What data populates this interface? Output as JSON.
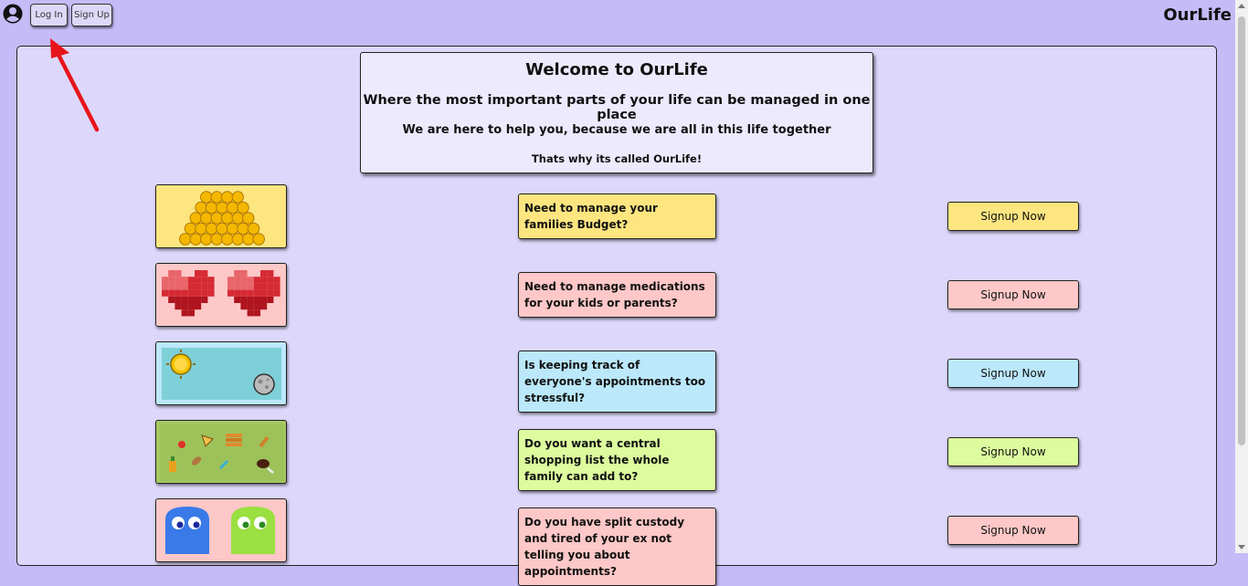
{
  "header": {
    "brand": "OurLife",
    "login_label": "Log In",
    "signup_label": "Sign Up"
  },
  "welcome": {
    "title": "Welcome to OurLife",
    "subtitle": "Where the most important parts of your life can be managed in one place",
    "line3": "We are here to help you, because we are all in this life together",
    "line4": "Thats why its called OurLife!"
  },
  "features": [
    {
      "icon": "gold-coins-icon",
      "question": "Need to manage your families Budget?",
      "button": "Signup Now",
      "color": "#fde580"
    },
    {
      "icon": "pixel-hearts-icon",
      "question": "Need to manage medications for your kids or parents?",
      "button": "Signup Now",
      "color": "#fdc8c7"
    },
    {
      "icon": "sun-moon-icon",
      "question": "Is keeping track of everyone's appointments too stressful?",
      "button": "Signup Now",
      "color": "#bbe8fb"
    },
    {
      "icon": "groceries-icon",
      "question": "Do you want a central shopping list the whole family can add to?",
      "button": "Signup Now",
      "color": "#dcfc9e"
    },
    {
      "icon": "ghosts-icon",
      "question": "Do you have split custody and tired of your ex not telling you about appointments?",
      "button": "Signup Now",
      "color": "#fdc8c7"
    }
  ],
  "colors": {
    "page_bg": "#c5bbf7",
    "panel_bg": "#ddd8fb",
    "annotation_arrow": "#e8141b"
  }
}
